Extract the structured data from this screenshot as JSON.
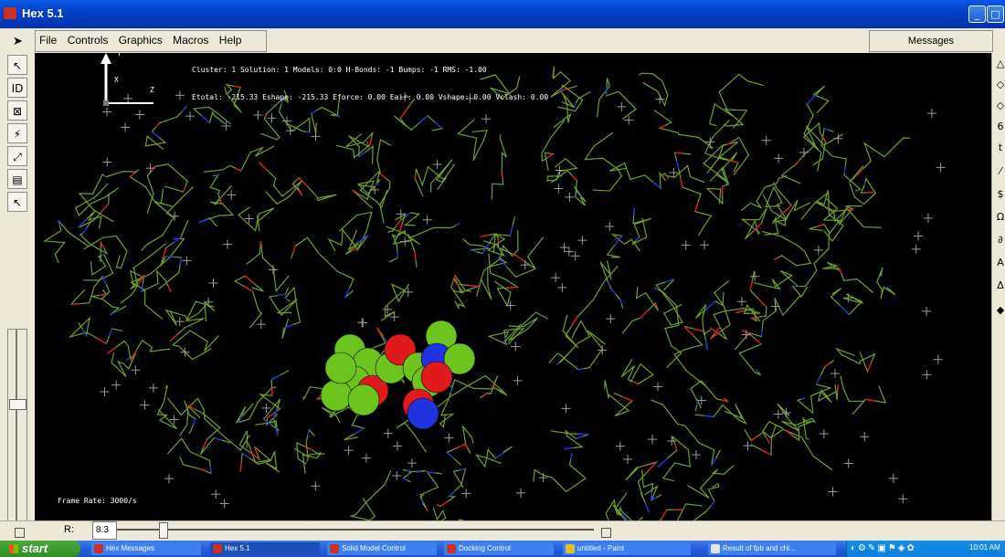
{
  "window": {
    "title": "Hex 5.1",
    "minimize": "_",
    "maximize": "□",
    "close": "✕"
  },
  "menubar": {
    "file": "File",
    "controls": "Controls",
    "graphics": "Graphics",
    "macros": "Macros",
    "help": "Help",
    "messages": "Messages"
  },
  "toolbar_left": [
    "↖",
    "ID",
    "⊠",
    "⚡",
    "⤢",
    "▤",
    "↖"
  ],
  "toolbar_right": [
    "△",
    "◇",
    "◇",
    "6",
    "t",
    "⁄",
    "$",
    "Ω",
    "∂",
    "A",
    "Δ",
    "◆"
  ],
  "viewport": {
    "cluster_line": "Cluster: 1 Solution: 1 Models: 0:0 H-Bonds: -1 Bumps: -1 RMS: -1.00",
    "energy_line": "Etotal: -215.33 Eshape: -215.33 Eforce: 0.00 Eair: 0.00 Vshape: 0.00 Vclash: 0.00",
    "frame_rate": "Frame Rate: 3000/s",
    "axis_x": "X",
    "axis_y": "Y",
    "axis_z": "Z",
    "colors": {
      "background": "#000000",
      "bond": "#6fa12a",
      "nitrogen": "#1f33e0",
      "oxygen": "#e01a1a",
      "ligand_carbon": "#6cc41c"
    }
  },
  "bottom": {
    "r_label": "R:",
    "r_value": "8.3",
    "slider_level": 0.09
  },
  "taskbar": {
    "start": "start",
    "tasks": [
      "Hex Messages",
      "Hex 5.1",
      "Solid Model Control",
      "Docking Control",
      "untitled - Paint",
      "Result of fpb and chl..."
    ],
    "clock": "10:01 AM"
  }
}
